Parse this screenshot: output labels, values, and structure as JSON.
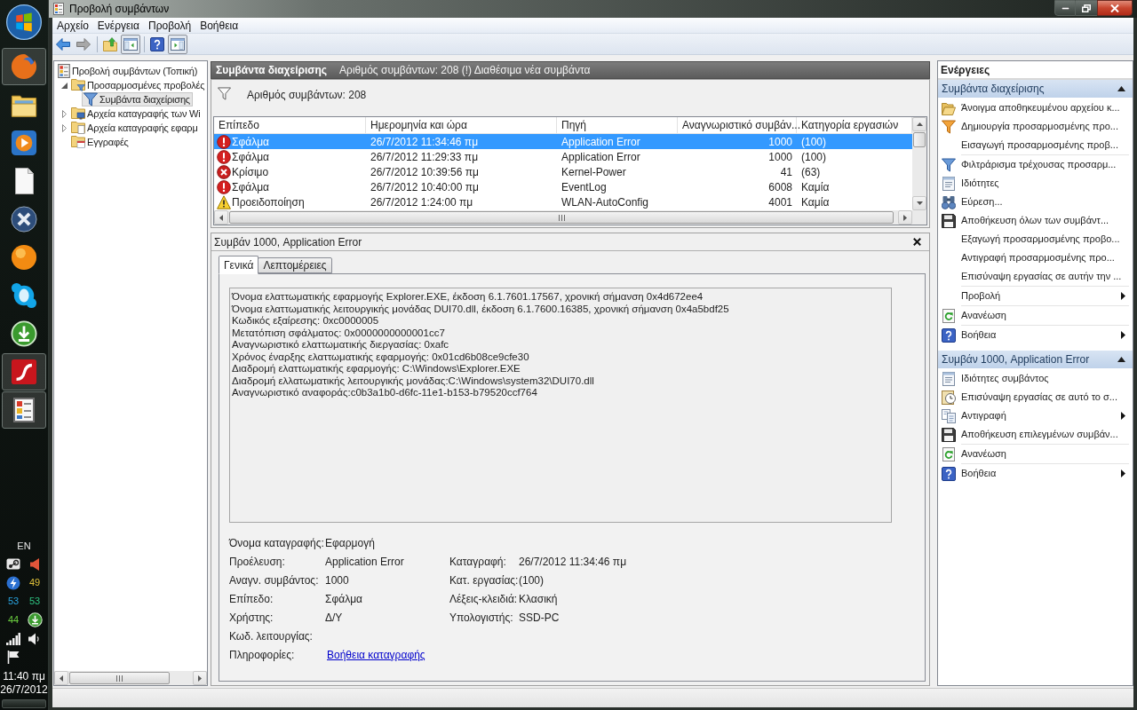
{
  "window": {
    "title": "Προβολή συμβάντων"
  },
  "menu": [
    "Αρχείο",
    "Ενέργεια",
    "Προβολή",
    "Βοήθεια"
  ],
  "toolbar": [
    [
      {
        "pressed": false,
        "disabled": false
      },
      {
        "pressed": false,
        "disabled": true
      }
    ],
    [
      {
        "pressed": false,
        "disabled": false
      },
      {
        "pressed": true,
        "disabled": false
      }
    ],
    [
      {
        "pressed": false,
        "disabled": false
      },
      {
        "pressed": true,
        "disabled": false
      }
    ]
  ],
  "tree": [
    {
      "label": "Προβολή συμβάντων (Τοπική)",
      "selected": false,
      "children": [
        {
          "label": "Προσαρμοσμένες προβολές",
          "expanded": true,
          "selected": false,
          "children": [
            {
              "label": "Συμβάντα διαχείρισης",
              "selected": true
            }
          ]
        },
        {
          "label": "Αρχεία καταγραφής των Wi",
          "expanded": false,
          "selected": false
        },
        {
          "label": "Αρχεία καταγραφής εφαρμ",
          "expanded": false,
          "selected": false
        },
        {
          "label": "Εγγραφές",
          "selected": false
        }
      ]
    }
  ],
  "view_header": {
    "title": "Συμβάντα διαχείρισης",
    "status": "Αριθμός συμβάντων: 208 (!) Διαθέσιμα νέα συμβάντα"
  },
  "filter_info": "Αριθμός συμβάντων: 208",
  "events": {
    "columns": [
      "Επίπεδο",
      "Ημερομηνία και ώρα",
      "Πηγή",
      "Αναγνωριστικό συμβάν...",
      "Κατηγορία εργασιών"
    ],
    "rows": [
      {
        "kind": "error",
        "selected": true,
        "cells": [
          "Σφάλμα",
          "26/7/2012 11:34:46 πμ",
          "Application Error",
          "1000",
          "(100)"
        ]
      },
      {
        "kind": "error",
        "selected": false,
        "cells": [
          "Σφάλμα",
          "26/7/2012 11:29:33 πμ",
          "Application Error",
          "1000",
          "(100)"
        ]
      },
      {
        "kind": "critical",
        "selected": false,
        "cells": [
          "Κρίσιμο",
          "26/7/2012 10:39:56 πμ",
          "Kernel-Power",
          "41",
          "(63)"
        ]
      },
      {
        "kind": "error",
        "selected": false,
        "cells": [
          "Σφάλμα",
          "26/7/2012 10:40:00 πμ",
          "EventLog",
          "6008",
          "Καμία"
        ]
      },
      {
        "kind": "warning",
        "selected": false,
        "cells": [
          "Προειδοποίηση",
          "26/7/2012 1:24:00 πμ",
          "WLAN-AutoConfig",
          "4001",
          "Καμία"
        ]
      }
    ]
  },
  "details": {
    "title": "Συμβάν 1000, Application Error",
    "tabs": [
      {
        "label": "Γενικά",
        "selected": true
      },
      {
        "label": "Λεπτομέρειες",
        "selected": false
      }
    ],
    "description_lines": [
      "Όνομα ελαττωματικής εφαρμογής Explorer.EXE, έκδοση 6.1.7601.17567, χρονική σήμανση 0x4d672ee4",
      "Όνομα ελαττωματικής λειτουργικής μονάδας DUI70.dll, έκδοση 6.1.7600.16385, χρονική σήμανση 0x4a5bdf25",
      "Κωδικός εξαίρεσης: 0xc0000005",
      "Μετατόπιση σφάλματος: 0x0000000000001cc7",
      "Αναγνωριστικό ελαττωματικής διεργασίας: 0xafc",
      "Χρόνος έναρξης ελαττωματικής εφαρμογής: 0x01cd6b08ce9cfe30",
      "Διαδρομή ελαττωματικής εφαρμογής: C:\\Windows\\Explorer.EXE",
      "Διαδρομή ελλατωματικής λειτουργικής μονάδας:C:\\Windows\\system32\\DUI70.dll",
      "Αναγνωριστικό αναφοράς:c0b3a1b0-d6fc-11e1-b153-b79520ccf764"
    ],
    "properties": [
      {
        "left": {
          "label": "Όνομα καταγραφής:",
          "value": "Εφαρμογή"
        }
      },
      {
        "left": {
          "label": "Προέλευση:",
          "value": "Application Error"
        },
        "right": {
          "label": "Καταγραφή:",
          "value": "26/7/2012 11:34:46 πμ"
        }
      },
      {
        "left": {
          "label": "Αναγν. συμβάντος:",
          "value": "1000"
        },
        "right": {
          "label": "Κατ. εργασίας:",
          "value": "(100)"
        }
      },
      {
        "left": {
          "label": "Επίπεδο:",
          "value": "Σφάλμα"
        },
        "right": {
          "label": "Λέξεις-κλειδιά:",
          "value": "Κλασική"
        }
      },
      {
        "left": {
          "label": "Χρήστης:",
          "value": "Δ/Υ"
        },
        "right": {
          "label": "Υπολογιστής:",
          "value": "SSD-PC"
        }
      },
      {
        "left": {
          "label": "Κωδ. λειτουργίας:"
        }
      },
      {
        "left": {
          "label": "Πληροφορίες:",
          "link": "Βοήθεια καταγραφής"
        }
      }
    ]
  },
  "actions": {
    "title": "Ενέργειες",
    "sections": [
      {
        "title": "Συμβάντα διαχείρισης",
        "expanded": true,
        "groups": [
          [
            {
              "label": "Άνοιγμα αποθηκευμένου αρχείου κ...",
              "submenu": false
            },
            {
              "label": "Δημιουργία προσαρμοσμένης προ...",
              "submenu": false
            },
            {
              "label": "Εισαγωγή προσαρμοσμένης προβ...",
              "submenu": false
            }
          ],
          [
            {
              "label": "Φιλτράρισμα τρέχουσας προσαρμ...",
              "submenu": false
            },
            {
              "label": "Ιδιότητες",
              "submenu": false
            },
            {
              "label": "Εύρεση...",
              "submenu": false
            },
            {
              "label": "Αποθήκευση όλων των συμβάντ...",
              "submenu": false
            },
            {
              "label": "Εξαγωγή προσαρμοσμένης προβο...",
              "submenu": false
            },
            {
              "label": "Αντιγραφή προσαρμοσμένης προ...",
              "submenu": false
            },
            {
              "label": "Επισύναψη εργασίας σε αυτήν την ...",
              "submenu": false
            }
          ],
          [
            {
              "label": "Προβολή",
              "submenu": true
            }
          ],
          [
            {
              "label": "Ανανέωση",
              "submenu": false
            }
          ],
          [
            {
              "label": "Βοήθεια",
              "submenu": true
            }
          ]
        ]
      },
      {
        "title": "Συμβάν 1000, Application Error",
        "expanded": true,
        "groups": [
          [
            {
              "label": "Ιδιότητες συμβάντος",
              "submenu": false
            },
            {
              "label": "Επισύναψη εργασίας σε αυτό το σ...",
              "submenu": false
            },
            {
              "label": "Αντιγραφή",
              "submenu": true
            },
            {
              "label": "Αποθήκευση επιλεγμένων συμβάν...",
              "submenu": false
            }
          ],
          [
            {
              "label": "Ανανέωση",
              "submenu": false
            }
          ],
          [
            {
              "label": "Βοήθεια",
              "submenu": true
            }
          ]
        ]
      }
    ]
  },
  "taskbar": {
    "apps": [
      {
        "running": true
      },
      {
        "running": false
      },
      {
        "running": false
      },
      {
        "running": false
      },
      {
        "running": false
      },
      {
        "running": false
      },
      {
        "running": false
      },
      {
        "running": false
      },
      {
        "running": true
      },
      {
        "running": true
      }
    ],
    "tray": {
      "language": "EN",
      "items": [
        {
          "kind": "icon"
        },
        {
          "kind": "icon"
        },
        {
          "kind": "icon"
        },
        {
          "kind": "reading",
          "text": "49",
          "color": "#e0c03a"
        },
        {
          "kind": "reading",
          "text": "53",
          "color": "#2aa4e0"
        },
        {
          "kind": "reading",
          "text": "53",
          "color": "#2ec280"
        },
        {
          "kind": "reading",
          "text": "44",
          "color": "#6cd040"
        },
        {
          "kind": "icon"
        },
        {
          "kind": "icon"
        },
        {
          "kind": "icon"
        },
        {
          "kind": "icon"
        }
      ],
      "time": "11:40 πμ",
      "date": "26/7/2012"
    }
  }
}
